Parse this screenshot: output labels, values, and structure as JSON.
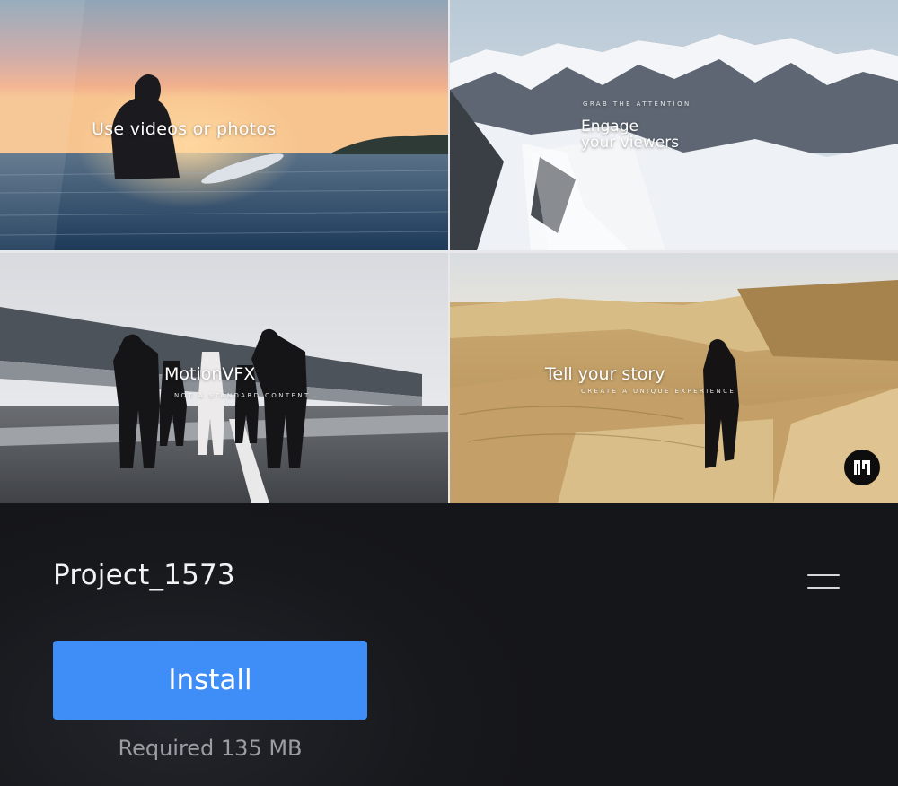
{
  "preview": {
    "tile1": {
      "caption": "Use videos or photos"
    },
    "tile2": {
      "eyebrow": "GRAB THE ATTENTION",
      "caption_line1": "Engage",
      "caption_line2": "your viewers"
    },
    "tile3": {
      "caption": "MotionVFX",
      "subcaption": "NOT A STANDARD CONTENT"
    },
    "tile4": {
      "caption": "Tell your story",
      "subcaption": "CREATE A UNIQUE EXPERIENCE"
    },
    "badge_icon": "motionvfx-logo-icon"
  },
  "project": {
    "title": "Project_1573",
    "menu_icon": "hamburger-menu-icon"
  },
  "install": {
    "button_label": "Install",
    "required_text": "Required 135 MB",
    "accent_color": "#3f8ef8"
  }
}
